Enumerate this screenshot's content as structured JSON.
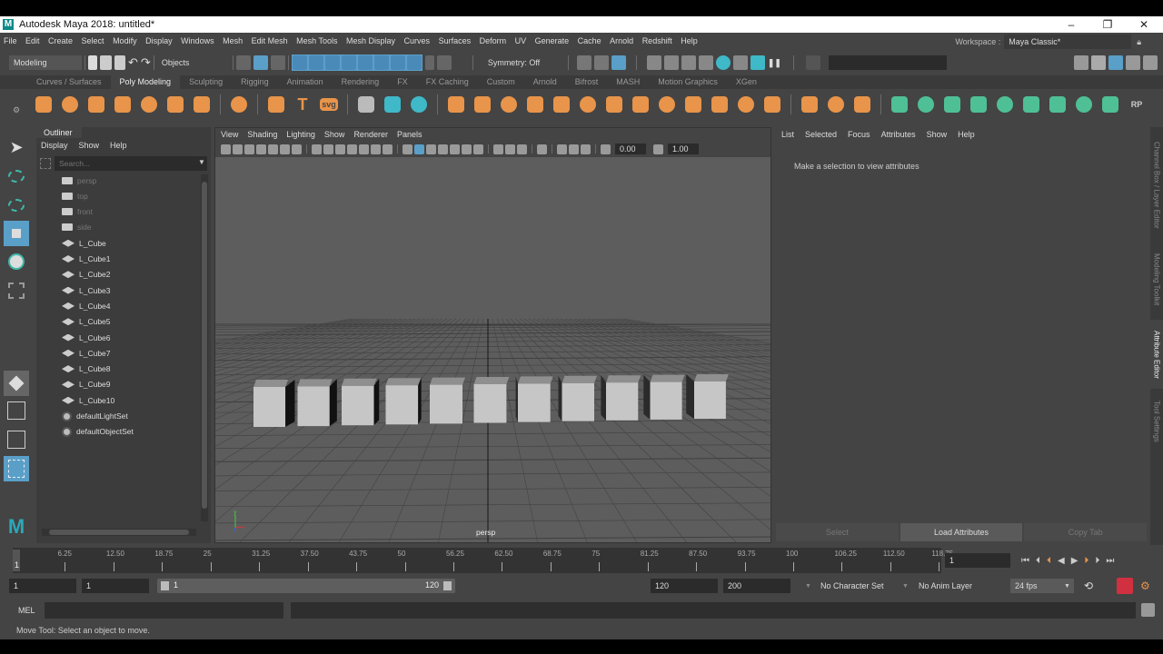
{
  "window": {
    "title": "Autodesk Maya 2018: untitled*",
    "logo": "M",
    "minimize": "–",
    "maximize": "❐",
    "close": "✕"
  },
  "menu": [
    "File",
    "Edit",
    "Create",
    "Select",
    "Modify",
    "Display",
    "Windows",
    "Mesh",
    "Edit Mesh",
    "Mesh Tools",
    "Mesh Display",
    "Curves",
    "Surfaces",
    "Deform",
    "UV",
    "Generate",
    "Cache",
    "Arnold",
    "Redshift",
    "Help"
  ],
  "workspace": {
    "label": "Workspace :",
    "value": "Maya Classic*"
  },
  "statusline": {
    "menuset": "Modeling",
    "selection_mode": "Objects",
    "symmetry": "Symmetry: Off"
  },
  "shelf": {
    "tabs": [
      "Curves / Surfaces",
      "Poly Modeling",
      "Sculpting",
      "Rigging",
      "Animation",
      "Rendering",
      "FX",
      "FX Caching",
      "Custom",
      "Arnold",
      "Bifrost",
      "MASH",
      "Motion Graphics",
      "XGen"
    ],
    "active": "Poly Modeling",
    "icons": [
      {
        "name": "poly-sphere-icon",
        "color": "#e8944a"
      },
      {
        "name": "poly-cube-icon",
        "color": "#e8944a"
      },
      {
        "name": "poly-cylinder-icon",
        "color": "#e8944a"
      },
      {
        "name": "poly-cone-icon",
        "color": "#e8944a"
      },
      {
        "name": "poly-torus-icon",
        "color": "#e8944a"
      },
      {
        "name": "poly-plane-icon",
        "color": "#e8944a"
      },
      {
        "name": "poly-disc-icon",
        "color": "#e8944a"
      },
      {
        "name": "platonic-solid-icon",
        "color": "#e8944a",
        "sep": true
      },
      {
        "name": "sweep-star-icon",
        "color": "#e8944a",
        "sep": true
      },
      {
        "name": "type-text-icon",
        "color": "#e8944a",
        "glyph": "T"
      },
      {
        "name": "svg-icon",
        "color": "#e8944a",
        "glyph": "svg"
      },
      {
        "name": "mirror-icon",
        "color": "#bbbbbb",
        "sep": true
      },
      {
        "name": "center-pivot-icon",
        "color": "#3fb8c8"
      },
      {
        "name": "freeze-transform-icon",
        "color": "#3fb8c8"
      },
      {
        "name": "combine-icon",
        "color": "#e8944a",
        "sep": true
      },
      {
        "name": "separate-icon",
        "color": "#e8944a"
      },
      {
        "name": "extract-icon",
        "color": "#e8944a"
      },
      {
        "name": "smooth-icon",
        "color": "#e8944a"
      },
      {
        "name": "reduce-icon",
        "color": "#e8944a"
      },
      {
        "name": "fill-hole-icon",
        "color": "#e8944a"
      },
      {
        "name": "bevel-icon",
        "color": "#e8944a"
      },
      {
        "name": "bridge-icon",
        "color": "#e8944a"
      },
      {
        "name": "extrude-icon",
        "color": "#e8944a"
      },
      {
        "name": "append-icon",
        "color": "#e8944a"
      },
      {
        "name": "collapse-icon",
        "color": "#e8944a"
      },
      {
        "name": "connect-icon",
        "color": "#e8944a"
      },
      {
        "name": "merge-icon",
        "color": "#e8944a"
      },
      {
        "name": "multi-cut-icon",
        "color": "#e8944a",
        "sep": true
      },
      {
        "name": "target-weld-icon",
        "color": "#e8944a"
      },
      {
        "name": "quad-draw-icon",
        "color": "#e8944a"
      },
      {
        "name": "planar-uv-icon",
        "color": "#4fbf96",
        "sep": true
      },
      {
        "name": "automatic-uv-icon",
        "color": "#4fbf96"
      },
      {
        "name": "cylindrical-uv-icon",
        "color": "#4fbf96"
      },
      {
        "name": "spherical-uv-icon",
        "color": "#4fbf96"
      },
      {
        "name": "cut-uv-icon",
        "color": "#4fbf96"
      },
      {
        "name": "unfold-uv-icon",
        "color": "#4fbf96"
      },
      {
        "name": "layout-uv-icon",
        "color": "#4fbf96"
      },
      {
        "name": "sew-uv-icon",
        "color": "#4fbf96"
      },
      {
        "name": "uv-editor-icon",
        "color": "#4fbf96"
      },
      {
        "name": "redshift-rp-icon",
        "color": "#cccccc",
        "glyph": "RP"
      }
    ]
  },
  "outliner": {
    "title": "Outliner",
    "menu": [
      "Display",
      "Show",
      "Help"
    ],
    "search_placeholder": "Search...",
    "items": [
      {
        "label": "persp",
        "type": "camera",
        "dim": true
      },
      {
        "label": "top",
        "type": "camera",
        "dim": true
      },
      {
        "label": "front",
        "type": "camera",
        "dim": true
      },
      {
        "label": "side",
        "type": "camera",
        "dim": true
      },
      {
        "label": "L_Cube",
        "type": "mesh"
      },
      {
        "label": "L_Cube1",
        "type": "mesh"
      },
      {
        "label": "L_Cube2",
        "type": "mesh"
      },
      {
        "label": "L_Cube3",
        "type": "mesh"
      },
      {
        "label": "L_Cube4",
        "type": "mesh"
      },
      {
        "label": "L_Cube5",
        "type": "mesh"
      },
      {
        "label": "L_Cube6",
        "type": "mesh"
      },
      {
        "label": "L_Cube7",
        "type": "mesh"
      },
      {
        "label": "L_Cube8",
        "type": "mesh"
      },
      {
        "label": "L_Cube9",
        "type": "mesh"
      },
      {
        "label": "L_Cube10",
        "type": "mesh"
      },
      {
        "label": "defaultLightSet",
        "type": "set"
      },
      {
        "label": "defaultObjectSet",
        "type": "set"
      }
    ]
  },
  "viewport": {
    "menu": [
      "View",
      "Shading",
      "Lighting",
      "Show",
      "Renderer",
      "Panels"
    ],
    "exposure": "0.00",
    "gamma": "1.00",
    "camera_label": "persp",
    "axis": {
      "y": "y",
      "x": "x",
      "z": "z"
    },
    "cube_count": 11
  },
  "attribute_editor": {
    "menu": [
      "List",
      "Selected",
      "Focus",
      "Attributes",
      "Show",
      "Help"
    ],
    "message": "Make a selection to view attributes",
    "buttons": [
      "Select",
      "Load Attributes",
      "Copy Tab"
    ]
  },
  "side_tabs": [
    "Channel Box / Layer Editor",
    "Modeling Toolkit",
    "Attribute Editor",
    "Tool Settings"
  ],
  "timeline": {
    "start_marker": "1",
    "ticks": [
      "6.25",
      "12.50",
      "18.75",
      "25",
      "31.25",
      "37.50",
      "43.75",
      "50",
      "56.25",
      "62.50",
      "68.75",
      "75",
      "81.25",
      "87.50",
      "93.75",
      "100",
      "106.25",
      "112.50",
      "118.75"
    ],
    "current_frame": "1",
    "current_fraction": 0
  },
  "range": {
    "start": "1",
    "playback_start": "1",
    "slider_start": "1",
    "slider_end": "120",
    "playback_end": "120",
    "end": "200",
    "character_set": "No Character Set",
    "anim_layer": "No Anim Layer",
    "fps": "24 fps"
  },
  "command": {
    "label": "MEL"
  },
  "help_line": "Move Tool: Select an object to move."
}
